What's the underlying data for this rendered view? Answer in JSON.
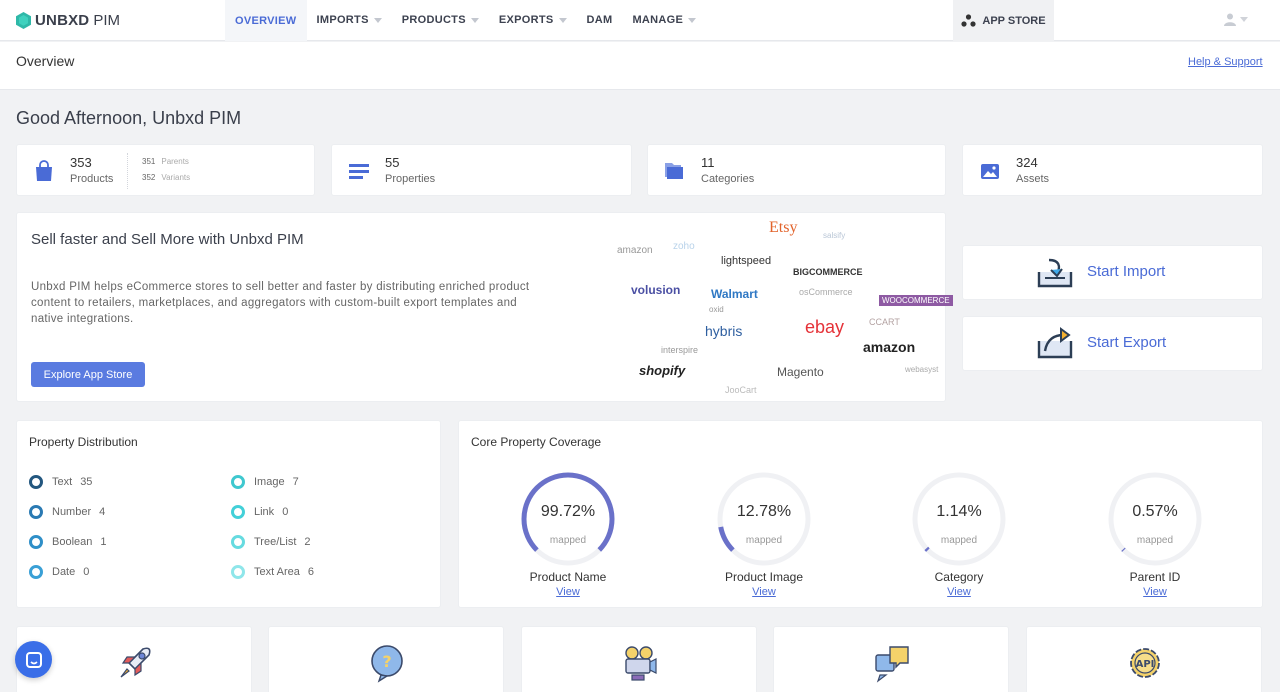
{
  "app": {
    "brand": "UNBXD",
    "brand_suffix": "PIM"
  },
  "nav": {
    "items": [
      {
        "label": "OVERVIEW",
        "active": true,
        "caret": false
      },
      {
        "label": "IMPORTS",
        "active": false,
        "caret": true
      },
      {
        "label": "PRODUCTS",
        "active": false,
        "caret": true
      },
      {
        "label": "EXPORTS",
        "active": false,
        "caret": true
      },
      {
        "label": "DAM",
        "active": false,
        "caret": false
      },
      {
        "label": "MANAGE",
        "active": false,
        "caret": true
      }
    ],
    "app_store": "APP STORE"
  },
  "page": {
    "title": "Overview",
    "help": "Help & Support",
    "greeting": "Good Afternoon, Unbxd PIM"
  },
  "stats": {
    "products": {
      "value": "353",
      "label": "Products",
      "parents_value": "351",
      "parents_label": "Parents",
      "variants_value": "352",
      "variants_label": "Variants"
    },
    "properties": {
      "value": "55",
      "label": "Properties"
    },
    "categories": {
      "value": "11",
      "label": "Categories"
    },
    "assets": {
      "value": "324",
      "label": "Assets"
    }
  },
  "promo": {
    "heading": "Sell faster and Sell More with Unbxd PIM",
    "body": "Unbxd PIM helps eCommerce stores to sell better and faster by distributing enriched product content to retailers, marketplaces, and aggregators with custom-built export templates and native integrations.",
    "button": "Explore App Store",
    "logos": [
      "Etsy",
      "amazon",
      "lightspeed",
      "BIGCOMMERCE",
      "volusion",
      "Walmart",
      "WOOCOMMERCE",
      "hybris",
      "ebay",
      "amazon",
      "shopify",
      "Magento",
      "CCART",
      "oxid",
      "osCommerce",
      "interspire",
      "JooCart",
      "webasyst",
      "salsify",
      "zoho"
    ]
  },
  "actions": {
    "import": "Start Import",
    "export": "Start Export"
  },
  "distribution": {
    "title": "Property Distribution",
    "items": [
      {
        "label": "Text",
        "count": "35",
        "color": "#23577f"
      },
      {
        "label": "Number",
        "count": "4",
        "color": "#2a7ab3"
      },
      {
        "label": "Boolean",
        "count": "1",
        "color": "#2f8fc8"
      },
      {
        "label": "Date",
        "count": "0",
        "color": "#3aa0d6"
      },
      {
        "label": "Image",
        "count": "7",
        "color": "#3fc8cf"
      },
      {
        "label": "Link",
        "count": "0",
        "color": "#43d0d8"
      },
      {
        "label": "Tree/List",
        "count": "2",
        "color": "#66dbe0"
      },
      {
        "label": "Text Area",
        "count": "6",
        "color": "#8fe6ea"
      }
    ]
  },
  "coverage": {
    "title": "Core Property Coverage",
    "mapped_label": "mapped",
    "view_label": "View",
    "items": [
      {
        "name": "Product Name",
        "percent": "99.72%",
        "fraction": 0.9972
      },
      {
        "name": "Product Image",
        "percent": "12.78%",
        "fraction": 0.1278
      },
      {
        "name": "Category",
        "percent": "1.14%",
        "fraction": 0.0114
      },
      {
        "name": "Parent ID",
        "percent": "0.57%",
        "fraction": 0.0057
      }
    ]
  },
  "colors": {
    "accent": "#4a6bd6",
    "gauge": "#6a71c9",
    "button": "#5a7be0",
    "chat": "#3a6ee8"
  }
}
